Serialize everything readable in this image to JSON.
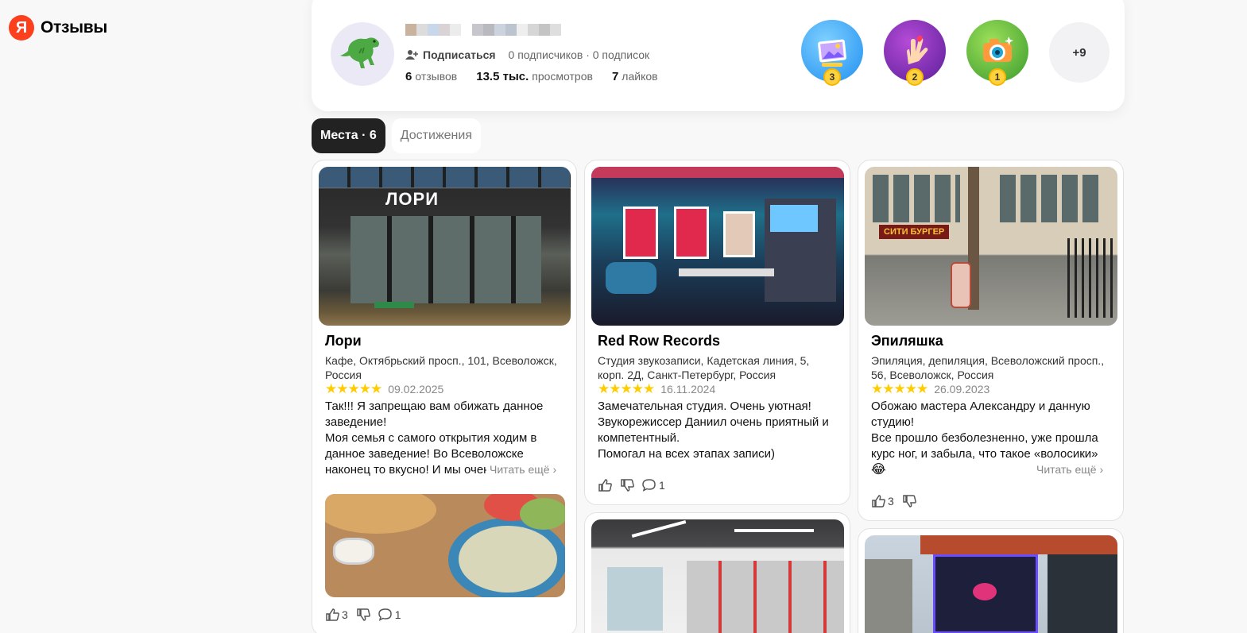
{
  "app": {
    "logo_letter": "Я",
    "title": "Отзывы",
    "brand_color": "#fc3f1d"
  },
  "profile": {
    "subscribe_label": "Подписаться",
    "followers_text": "0 подписчиков · 0 подписок",
    "reviews_num": "6",
    "reviews_label": "отзывов",
    "views_num": "13.5 тыс.",
    "views_label": "просмотров",
    "likes_num": "7",
    "likes_label": "лайков",
    "badges": [
      {
        "icon": "photo-badge-icon",
        "count": "3"
      },
      {
        "icon": "hand-heart-badge-icon",
        "count": "2"
      },
      {
        "icon": "camera-badge-icon",
        "count": "1"
      }
    ],
    "more_badges": "+9"
  },
  "tabs": {
    "places": "Места · 6",
    "achievements": "Достижения"
  },
  "cards": [
    {
      "title": "Лори",
      "address": "Кафе, Октябрьский просп., 101, Всеволожск, Россия",
      "stars": "★★★★★",
      "date": "09.02.2025",
      "review": "Так!!! Я запрещаю вам обижать данное заведение!\nМоя семья с самого открытия ходим в данное заведение! Во Всеволожске наконец то вкусно! И мы очень",
      "read_more": "Читать ещё ›",
      "likes": "3",
      "comments": "1",
      "photo_sign": "ЛОРИ"
    },
    {
      "title": "Red Row Records",
      "address": "Студия звукозаписи, Кадетская линия, 5, корп. 2Д, Санкт-Петербург, Россия",
      "stars": "★★★★★",
      "date": "16.11.2024",
      "review": "Замечательная студия. Очень уютная! Звукорежиссер Даниил очень приятный и компетентный.\nПомогал на всех этапах записи)",
      "comments": "1"
    },
    {
      "title": "Эпиляшка",
      "address": "Эпиляция, депиляция, Всеволожский просп., 56, Всеволожск, Россия",
      "stars": "★★★★★",
      "date": "26.09.2023",
      "review": "Обожаю мастера Александру и данную студию!\nВсе прошло безболезненно, уже прошла курс ног, и забыла, что такое «волосики»",
      "emoji": "😂",
      "read_more": "Читать ещё ›",
      "likes": "3",
      "photo_sign": "СИТИ БУРГЕР"
    }
  ]
}
